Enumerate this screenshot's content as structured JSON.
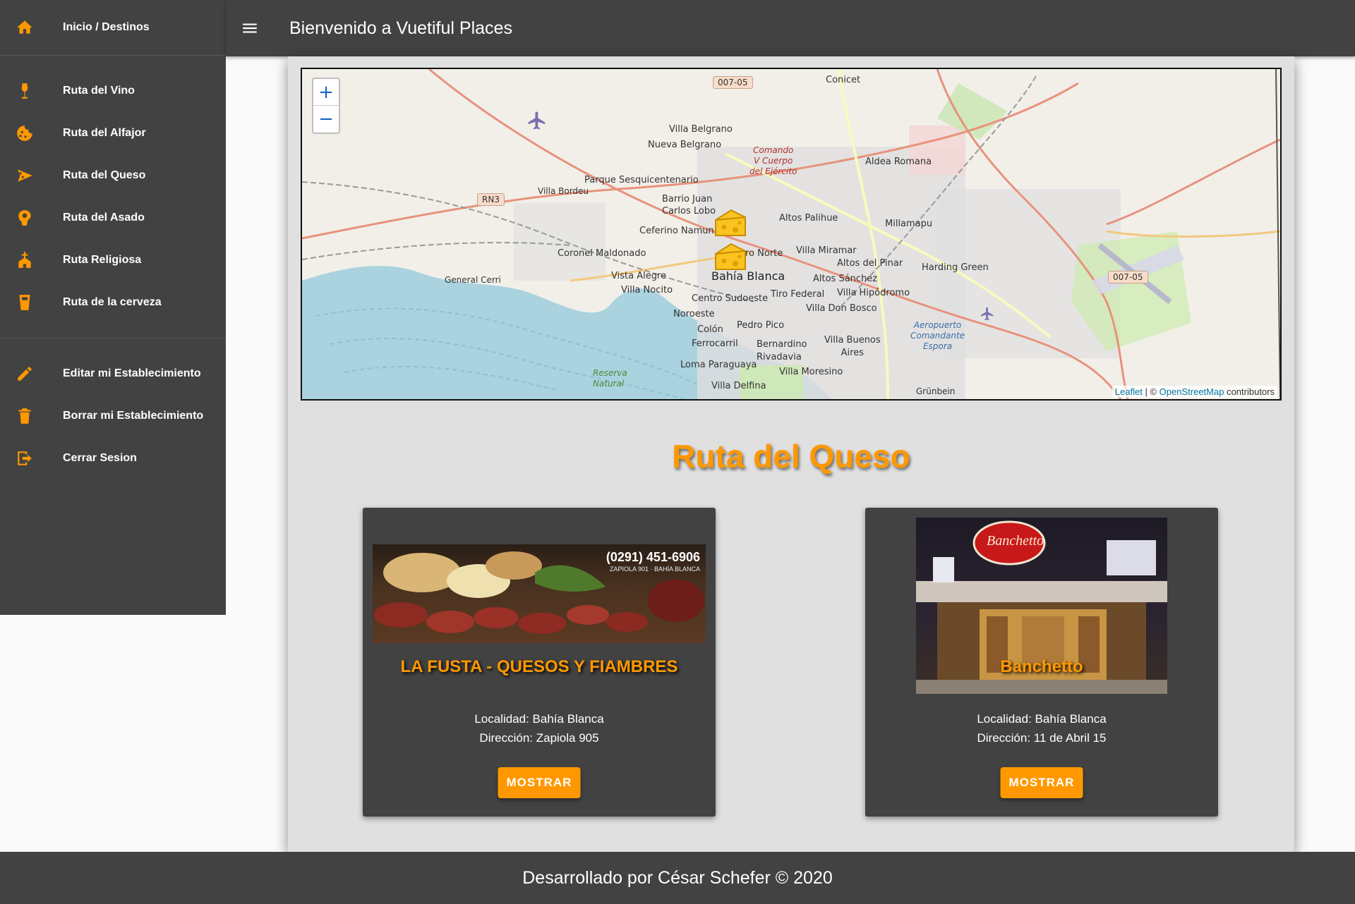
{
  "app": {
    "title": "Bienvenido a Vuetiful Places"
  },
  "sidebar": {
    "home": {
      "label": "Inicio / Destinos",
      "icon": "home-icon"
    },
    "routes": [
      {
        "label": "Ruta del Vino",
        "icon": "wine-icon"
      },
      {
        "label": "Ruta del Alfajor",
        "icon": "cookie-icon"
      },
      {
        "label": "Ruta del Queso",
        "icon": "cheese-icon"
      },
      {
        "label": "Ruta del Asado",
        "icon": "meat-icon"
      },
      {
        "label": "Ruta Religiosa",
        "icon": "church-icon"
      },
      {
        "label": "Ruta de la cerveza",
        "icon": "beer-icon"
      }
    ],
    "account": [
      {
        "label": "Editar mi Establecimiento",
        "icon": "pencil-icon"
      },
      {
        "label": "Borrar mi Establecimiento",
        "icon": "trash-icon"
      },
      {
        "label": "Cerrar Sesion",
        "icon": "logout-icon"
      }
    ]
  },
  "map": {
    "zoom_in": "+",
    "zoom_out": "−",
    "attribution": {
      "leaflet": "Leaflet",
      "sep": " | © ",
      "osm": "OpenStreetMap",
      "suffix": " contributors"
    },
    "labels": {
      "conicet": "Conicet",
      "villa_belgrano": "Villa Belgrano",
      "nueva_belgrano": "Nueva Belgrano",
      "comando": "Comando\nV Cuerpo\ndel Ejército",
      "parque": "Parque Sesquicentenario",
      "villa_bordeu": "Villa Bordeu",
      "barrio_juan": "Barrio Juan\nCarlos Lobo",
      "aldea_romana": "Aldea Romana",
      "altos_palihue": "Altos Palihue",
      "millamapu": "Millamapu",
      "ceferino": "Ceferino Namun",
      "coronel": "Coronel Maldonado",
      "barrio_norte": "ro Norte",
      "villa_miramar": "Villa Miramar",
      "altos_pinar": "Altos del Pinar",
      "harding": "Harding Green",
      "general_cerri": "General Cerri",
      "vista_alegre": "Vista Alegre",
      "bahia_blanca": "Bahía Blanca",
      "altos_sanchez": "Altos Sánchez",
      "villa_nocito": "Villa Nocito",
      "centro_sudoeste": "Centro Sudoeste",
      "tiro_federal": "Tiro Federal",
      "villa_hipodromo": "Villa Hipódromo",
      "noroeste": "Noroeste",
      "villa_don_bosco": "Villa Don Bosco",
      "aeropuerto": "Aeropuerto\nComandante\nEspora",
      "colon": "Colón",
      "pedro_pico": "Pedro Pico",
      "ferrocarril": "Ferrocarril",
      "bernardino": "Bernardino\nRivadavia",
      "villa_buenos_aires": "Villa Buenos\nAires",
      "reserva": "Reserva\nNatural",
      "loma_paraguaya": "Loma Paraguaya",
      "villa_moresino": "Villa Moresino",
      "villa_delfina": "Villa Delfina",
      "grunbein": "Grünbein",
      "shield_top": "007-05",
      "shield_right": "007-05",
      "shield_rn3": "RN3"
    }
  },
  "section": {
    "title": "Ruta del Queso"
  },
  "cards": [
    {
      "name": "LA FUSTA - QUESOS Y FIAMBRES",
      "photo_phone": "(0291) 451-6906",
      "photo_addr": "ZAPIOLA 901 · BAHÍA BLANCA",
      "localidad": "Localidad: Bahía Blanca",
      "direccion": "Dirección: Zapiola 905",
      "button": "MOSTRAR"
    },
    {
      "name": "Banchetto",
      "photo_sign": "Banchetto",
      "localidad": "Localidad: Bahía Blanca",
      "direccion": "Dirección: 11 de Abril 15",
      "button": "MOSTRAR"
    }
  ],
  "footer": {
    "text": "Desarrollado por César Schefer © 2020"
  },
  "colors": {
    "accent": "#ff9800",
    "dark": "#424242",
    "sheet": "#e0e0e0"
  }
}
